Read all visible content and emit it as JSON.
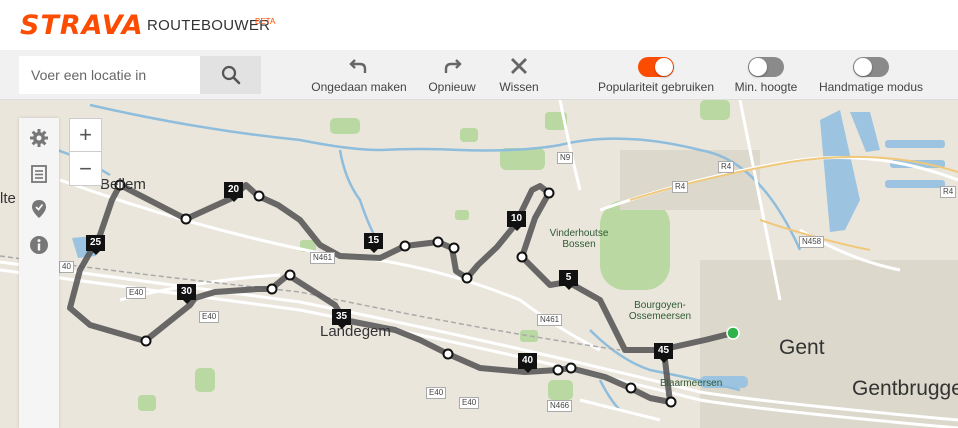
{
  "brand": {
    "logo": "STRAVA",
    "app_title": "ROUTEBOUWER",
    "badge": "BETA",
    "accent": "#fc4c02"
  },
  "search": {
    "placeholder": "Voer een locatie in",
    "value": ""
  },
  "toolbar": {
    "undo_label": "Ongedaan maken",
    "redo_label": "Opnieuw",
    "clear_label": "Wissen",
    "popularity_label": "Populariteit gebruiken",
    "popularity_on": true,
    "min_elevation_label": "Min. hoogte",
    "min_elevation_on": false,
    "manual_mode_label": "Handmatige modus",
    "manual_mode_on": false
  },
  "map": {
    "controls": {
      "zoom_in": "+",
      "zoom_out": "−",
      "side_icons": [
        "gear-icon",
        "list-icon",
        "map-pin-icon",
        "info-icon"
      ]
    },
    "places": [
      "Gent",
      "Gentbrugge",
      "Landegem",
      "Bellem",
      "Vinderhoutse Bossen",
      "Bourgoyen-Ossemeersen",
      "Blaarmeersen",
      "lte"
    ],
    "roads": [
      "N9",
      "R4",
      "R4",
      "R4",
      "N458",
      "N461",
      "N461",
      "N466",
      "E40",
      "E40",
      "E40",
      "E40",
      "40"
    ],
    "km_markers": [
      "5",
      "10",
      "15",
      "20",
      "25",
      "30",
      "35",
      "40",
      "45"
    ],
    "start_color": "#2fb34a",
    "route_color": "#555555"
  }
}
